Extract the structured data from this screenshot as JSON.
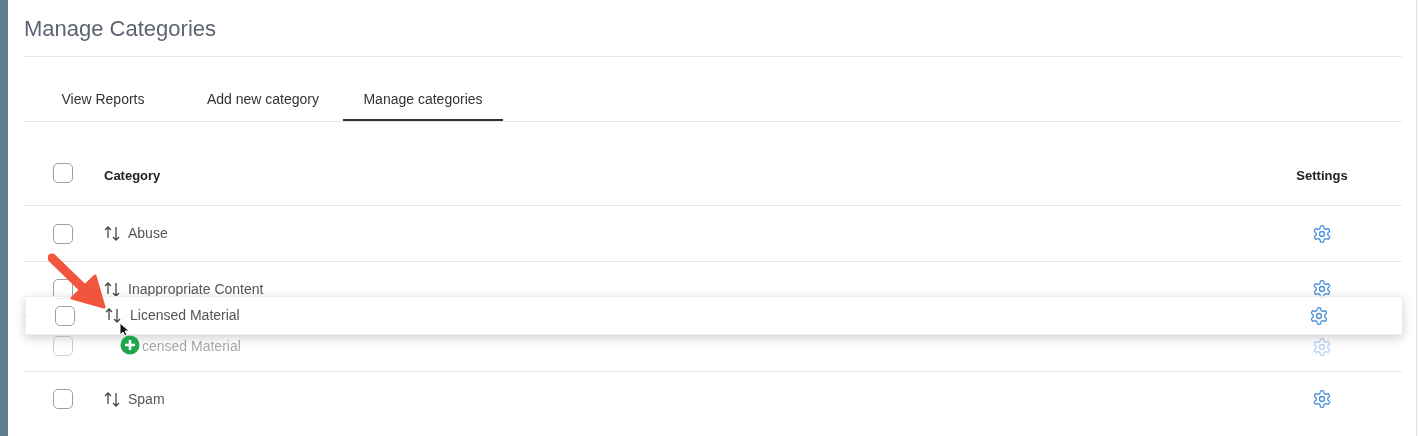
{
  "page": {
    "title": "Manage Categories"
  },
  "tabs": [
    {
      "label": "View Reports",
      "selected": false
    },
    {
      "label": "Add new category",
      "selected": false
    },
    {
      "label": "Manage categories",
      "selected": true
    }
  ],
  "table": {
    "columns": [
      "Category",
      "Settings"
    ],
    "header_checked": false,
    "rows": [
      {
        "label": "Abuse",
        "checked": false,
        "kind": "normal"
      },
      {
        "label": "Inappropriate Content",
        "checked": false,
        "kind": "normal"
      },
      {
        "label": "censed Material",
        "checked": false,
        "kind": "placeholder"
      },
      {
        "label": "Spam",
        "checked": false,
        "kind": "normal"
      }
    ]
  },
  "drag_preview": {
    "label": "Licensed Material",
    "checked": false
  }
}
